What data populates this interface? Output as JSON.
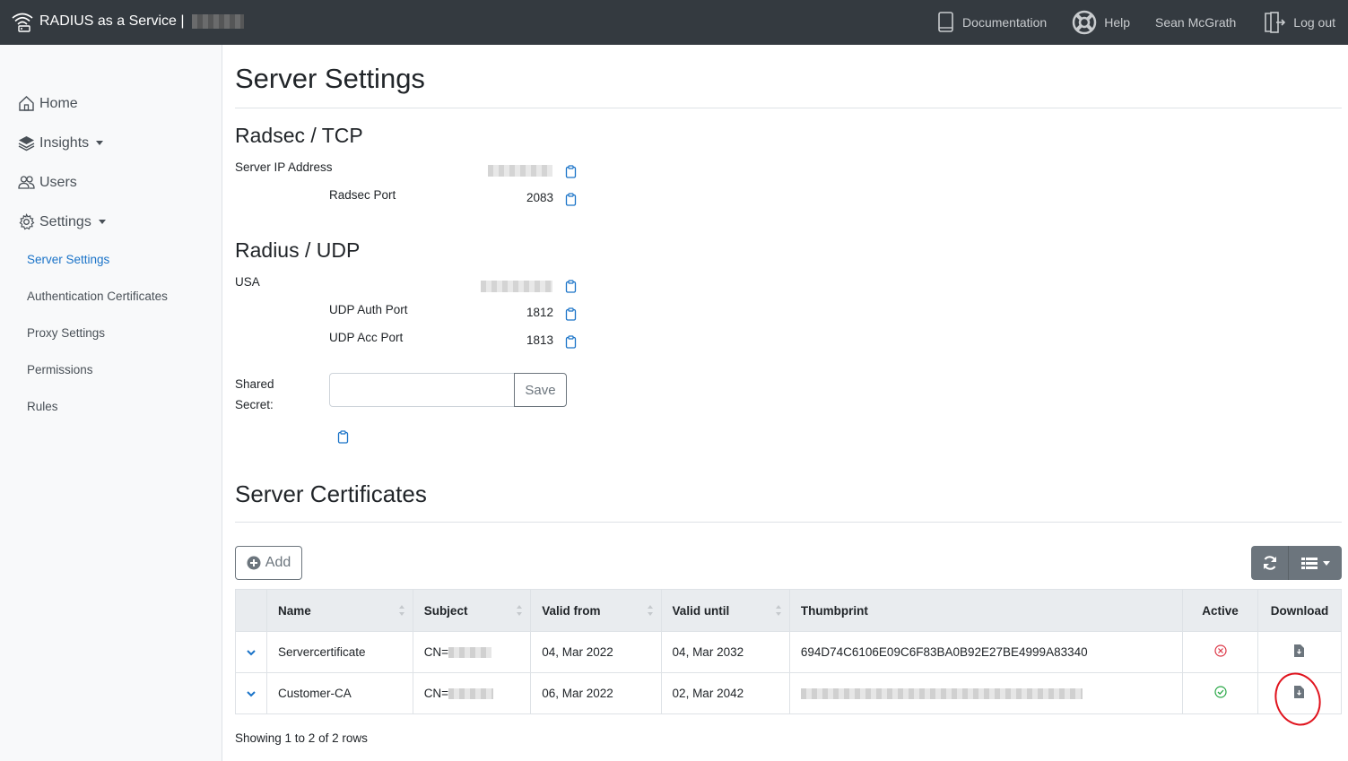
{
  "navbar": {
    "brand": "RADIUS as a Service |",
    "links": {
      "documentation": "Documentation",
      "help": "Help",
      "user": "Sean McGrath",
      "logout": "Log out"
    }
  },
  "sidebar": {
    "home": "Home",
    "insights": "Insights",
    "users": "Users",
    "settings": "Settings",
    "sub_items": [
      "Server Settings",
      "Authentication Certificates",
      "Proxy Settings",
      "Permissions",
      "Rules"
    ],
    "active_item": "Server Settings"
  },
  "page": {
    "title": "Server Settings",
    "radsec": {
      "heading": "Radsec / TCP",
      "server_ip_label": "Server IP Address",
      "port_label": "Radsec Port",
      "port_value": "2083"
    },
    "radius": {
      "heading": "Radius / UDP",
      "region_label": "USA",
      "auth_port_label": "UDP Auth Port",
      "auth_port_value": "1812",
      "acc_port_label": "UDP Acc Port",
      "acc_port_value": "1813",
      "shared_secret_label_1": "Shared",
      "shared_secret_label_2": "Secret:",
      "shared_secret_value": "",
      "save_label": "Save"
    },
    "certificates": {
      "heading": "Server Certificates",
      "add_label": "Add",
      "columns": [
        "Name",
        "Subject",
        "Valid from",
        "Valid until",
        "Thumbprint",
        "Active",
        "Download"
      ],
      "rows": [
        {
          "name": "Servercertificate",
          "subject": "CN=",
          "valid_from": "04, Mar 2022",
          "valid_until": "04, Mar 2032",
          "thumbprint": "694D74C6106E09C6F83BA0B92E27BE4999A83340",
          "active": false
        },
        {
          "name": "Customer-CA",
          "subject": "CN=",
          "valid_from": "06, Mar 2022",
          "valid_until": "02, Mar 2042",
          "thumbprint": "",
          "active": true
        }
      ],
      "footer": "Showing 1 to 2 of 2 rows"
    }
  },
  "colors": {
    "navbar_bg": "#343a40",
    "accent": "#1a73c8",
    "active_ok": "#28a745",
    "inactive": "#dc3545",
    "annotation": "#e0141e"
  }
}
